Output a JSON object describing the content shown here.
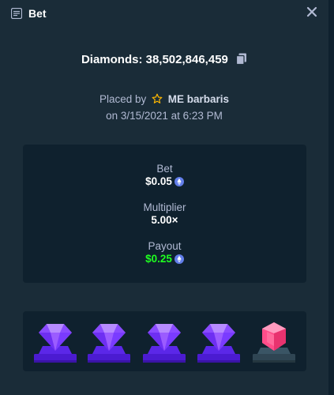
{
  "header": {
    "title": "Bet"
  },
  "bet_amount": {
    "label": "Diamonds: 38,502,846,459"
  },
  "placed": {
    "prefix": "Placed by",
    "username": "ME barbaris",
    "date": "on 3/15/2021 at 6:23 PM"
  },
  "stats": {
    "bet_label": "Bet",
    "bet_value": "$0.05",
    "multiplier_label": "Multiplier",
    "multiplier_value": "5.00×",
    "payout_label": "Payout",
    "payout_value": "$0.25"
  },
  "result_tiles": [
    "diamond-purple",
    "diamond-purple",
    "diamond-purple",
    "diamond-purple",
    "gem-pink"
  ],
  "colors": {
    "background": "#1a2c38",
    "panel": "#0f212e",
    "muted_text": "#b1bad3",
    "payout_green": "#1fff20",
    "coin_blue": "#627eea"
  }
}
